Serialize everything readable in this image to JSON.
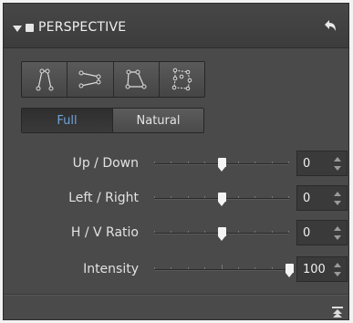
{
  "panel": {
    "title": "PERSPECTIVE",
    "icons": {
      "collapse": "triangle-down-icon",
      "enable": "checkbox-icon",
      "reset": "reset-arrow-icon",
      "collapse_all": "collapse-all-icon"
    }
  },
  "modes": [
    {
      "name": "vertical-mode",
      "icon": "vertical-perspective-icon"
    },
    {
      "name": "horizontal-mode",
      "icon": "horizontal-perspective-icon"
    },
    {
      "name": "rectangle-mode",
      "icon": "rectangle-perspective-icon"
    },
    {
      "name": "multipoint-mode",
      "icon": "multipoint-perspective-icon"
    }
  ],
  "segment": {
    "full": "Full",
    "natural": "Natural",
    "selected": "Full",
    "selected_color": "#6fa3d8"
  },
  "sliders": [
    {
      "label": "Up / Down",
      "value": "0",
      "position": 0.5
    },
    {
      "label": "Left / Right",
      "value": "0",
      "position": 0.5
    },
    {
      "label": "H / V Ratio",
      "value": "0",
      "position": 0.5
    },
    {
      "label": "Intensity",
      "value": "100",
      "position": 1.0
    }
  ]
}
